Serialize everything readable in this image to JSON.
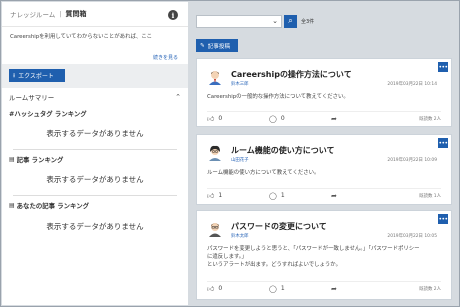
{
  "room": {
    "name": "ナレッジルーム",
    "separator": "|",
    "title": "質問箱",
    "info_icon": "i",
    "description": "Careershipを利用していてわからないことがあれば、ここ",
    "read_more": "続きを見る"
  },
  "toolbar": {
    "export_label": "エクスポート"
  },
  "summary": {
    "title": "ルームサマリー",
    "hashtag_ranking": "#ハッシュタグ ランキング",
    "article_ranking": "記事 ランキング",
    "my_article_ranking": "あなたの記事 ランキング",
    "no_data": "表示するデータがありません"
  },
  "search": {
    "select_value": "",
    "count": "全3件"
  },
  "post_button_label": "記事投稿",
  "posts": [
    {
      "title": "Careershipの操作方法について",
      "author": "鈴木三郎",
      "date": "2019年03月22日 10:14",
      "body": "Careershipの一般的な操作方法について教えてください。",
      "likes": "0",
      "comments": "0",
      "readers": "既読数 2人"
    },
    {
      "title": "ルーム機能の使い方について",
      "author": "山田花子",
      "date": "2019年03月22日 10:09",
      "body": "ルーム機能の使い方について教えてください。",
      "likes": "1",
      "comments": "1",
      "readers": "既読数 1人"
    },
    {
      "title": "パスワードの変更について",
      "author": "鈴木太郎",
      "date": "2019年03月22日 10:05",
      "body1": "パスワードを変更しようと思うと、「パスワードが一致しません。」「パスワードポリシー",
      "body2": "に違反します。」",
      "body3": "というアラートが出ます。どうすればよいでしょうか。",
      "likes": "0",
      "comments": "1",
      "readers": "既読数 2人"
    }
  ],
  "colors": {
    "accent": "#1f5fae",
    "background": "#d6dbe0",
    "link": "#2a66b8"
  }
}
